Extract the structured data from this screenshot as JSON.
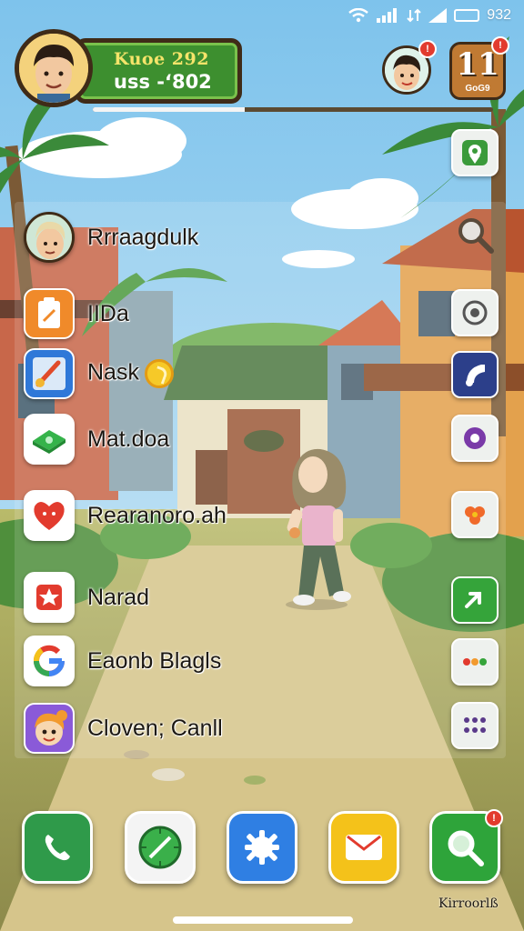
{
  "status_bar": {
    "wifi_icon": "wifi-icon",
    "signal_icon": "signal-icon",
    "battery_text": "932"
  },
  "profile": {
    "line1": "Kuoe 292",
    "line2": "uss -‘802"
  },
  "calendar": {
    "number": "11",
    "label": "GoG9"
  },
  "app_list": [
    {
      "label": "Rrraagdulk",
      "icon": "avatar-icon"
    },
    {
      "label": "IIDa",
      "icon": "notepad-icon"
    },
    {
      "label": "Nask",
      "icon": "paint-brush-icon",
      "has_coin": true
    },
    {
      "label": "Mat.doa",
      "icon": "money-icon"
    },
    {
      "label": "Rearanoro.ah",
      "icon": "heart-icon"
    },
    {
      "label": "Narad",
      "icon": "star-icon"
    },
    {
      "label": "Eaonb Blagls",
      "icon": "google-icon"
    },
    {
      "label": "Cloven; Canll",
      "icon": "character-icon"
    }
  ],
  "rail": [
    "map-pin-icon",
    "magnifier-icon",
    "camera-icon",
    "music-icon",
    "record-icon",
    "flower-icon",
    "arrow-icon",
    "chat-dots-icon",
    "grid-dots-icon"
  ],
  "dock": {
    "items": [
      "phone-icon",
      "compass-icon",
      "settings-icon",
      "mail-icon",
      "search-icon"
    ],
    "caption": "Kirroorlß",
    "search_badge": "!"
  },
  "colors": {
    "profile_green": "#3d8f2f",
    "phone_green": "#2f9a4a",
    "settings_blue": "#2f7fe3",
    "mail_yellow": "#f4c21a",
    "search_green": "#2ea43a"
  }
}
